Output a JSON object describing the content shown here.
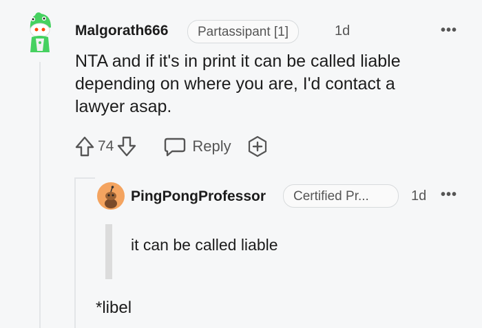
{
  "comment": {
    "username": "Malgorath666",
    "flair": "Partassipant [1]",
    "time": "1d",
    "more": "•••",
    "body_lines": [
      "NTA and if it's in print it can be called liable",
      "depending on where you are, I'd contact a",
      "lawyer asap."
    ],
    "votes": "74",
    "reply_label": "Reply",
    "avatar_icon": "snoo-avatar-icon",
    "colors": {
      "text": "#1c1c1c",
      "muted": "#555555",
      "background": "#f6f7f8",
      "avatar_green": "#46d160"
    }
  },
  "reply": {
    "username": "PingPongProfessor",
    "flair": "Certified Pr...",
    "time": "1d",
    "more": "•••",
    "quote": "it can be called liable",
    "body": "*libel",
    "avatar_icon": "snoo-avatar-icon",
    "colors": {
      "avatar_orange": "#f4a460"
    }
  }
}
